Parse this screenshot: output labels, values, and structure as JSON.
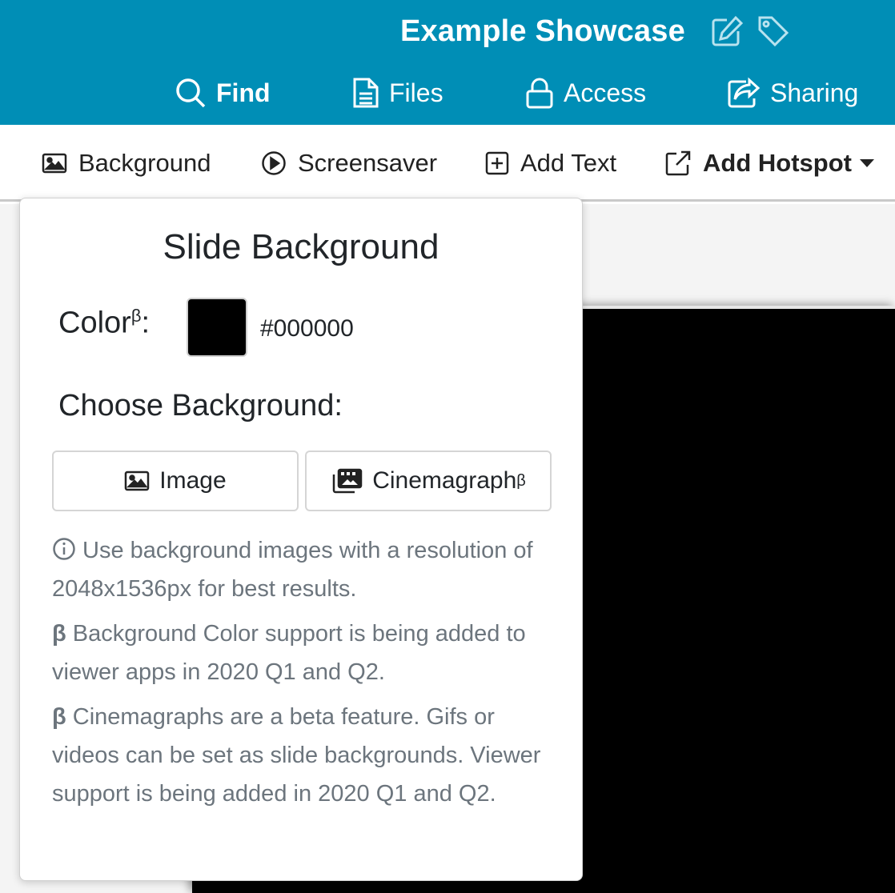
{
  "header": {
    "title": "Example Showcase",
    "brand_color": "#008eb6",
    "title_icons": [
      "edit-icon",
      "tag-icon"
    ]
  },
  "nav": {
    "find": "Find",
    "files": "Files",
    "access": "Access",
    "sharing": "Sharing"
  },
  "toolbar": {
    "background": "Background",
    "screensaver": "Screensaver",
    "add_text": "Add Text",
    "add_hotspot": "Add Hotspot"
  },
  "popover": {
    "title": "Slide Background",
    "color_label": "Color",
    "beta_mark": "β",
    "color_suffix": ":",
    "color_value": "#000000",
    "choose_label": "Choose Background:",
    "image_button": "Image",
    "cinemagraph_button": "Cinemagraph",
    "help_resolution": "Use background images with a resolution of 2048x1536px for best results.",
    "help_color_beta": "Background Color support is being added to viewer apps in 2020 Q1 and Q2.",
    "help_cinemagraph_beta": "Cinemagraphs are a beta feature. Gifs or videos can be set as slide backgrounds. Viewer support is being added in 2020 Q1 and Q2."
  },
  "slide": {
    "background_color": "#000000"
  }
}
